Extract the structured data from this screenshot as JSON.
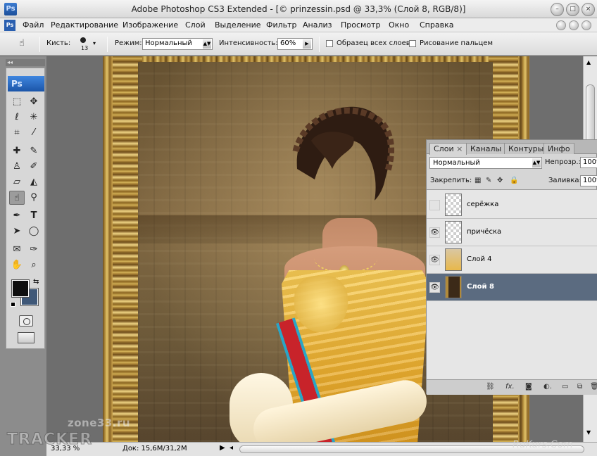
{
  "window": {
    "app_icon": "Ps",
    "title": "Adobe Photoshop CS3 Extended - [© prinzessin.psd @ 33,3% (Слой 8, RGB/8)]",
    "controls": [
      "minimize-icon",
      "maximize-icon",
      "close-icon"
    ]
  },
  "menu": {
    "app_icon": "Ps",
    "items": [
      "Файл",
      "Редактирование",
      "Изображение",
      "Слой",
      "Выделение",
      "Фильтр",
      "Анализ",
      "Просмотр",
      "Окно",
      "Справка"
    ]
  },
  "options": {
    "brush_label": "Кисть:",
    "brush_size": "13",
    "mode_label": "Режим:",
    "mode_value": "Нормальный",
    "intensity_label": "Интенсивность:",
    "intensity_value": "60%",
    "sample_all_label": "Образец всех слоев",
    "finger_paint_label": "Рисование пальцем",
    "sample_all_checked": false,
    "finger_paint_checked": false
  },
  "tools": {
    "logo": "Ps",
    "collapse_glyph": "◂◂",
    "items": [
      {
        "name": "marquee-tool",
        "glyph": "⬚"
      },
      {
        "name": "move-tool",
        "glyph": "✥"
      },
      {
        "name": "lasso-tool",
        "glyph": "ℓ"
      },
      {
        "name": "magic-wand-tool",
        "glyph": "✳"
      },
      {
        "name": "crop-tool",
        "glyph": "⌗"
      },
      {
        "name": "slice-tool",
        "glyph": "⁄"
      },
      {
        "name": "healing-brush-tool",
        "glyph": "✚"
      },
      {
        "name": "brush-tool",
        "glyph": "✎"
      },
      {
        "name": "clone-stamp-tool",
        "glyph": "♙"
      },
      {
        "name": "history-brush-tool",
        "glyph": "✐"
      },
      {
        "name": "eraser-tool",
        "glyph": "▱"
      },
      {
        "name": "paint-bucket-tool",
        "glyph": "◭"
      },
      {
        "name": "smudge-tool",
        "glyph": "☝"
      },
      {
        "name": "dodge-tool",
        "glyph": "🔍"
      },
      {
        "name": "pen-tool",
        "glyph": "✒"
      },
      {
        "name": "type-tool",
        "glyph": "T"
      },
      {
        "name": "path-selection-tool",
        "glyph": "➤"
      },
      {
        "name": "ellipse-tool",
        "glyph": "◯"
      },
      {
        "name": "notes-tool",
        "glyph": "✉"
      },
      {
        "name": "eyedropper-tool",
        "glyph": "✑"
      },
      {
        "name": "hand-tool",
        "glyph": "✋"
      },
      {
        "name": "zoom-tool",
        "glyph": "⌕"
      }
    ],
    "foreground_color": "#0f0f0f",
    "background_color": "#3f5878"
  },
  "layers_panel": {
    "tabs": [
      "Слои",
      "Каналы",
      "Контуры",
      "Инфо"
    ],
    "tab_close": "×",
    "blend_mode": "Нормальный",
    "opacity_label": "Непрозр.:",
    "opacity_value": "100%",
    "lock_label": "Закрепить:",
    "fill_label": "Заливка:",
    "fill_value": "100%",
    "layers": [
      {
        "name": "серёжка",
        "visible": false,
        "selected": false
      },
      {
        "name": "причёска",
        "visible": true,
        "selected": false
      },
      {
        "name": "Слой 4",
        "visible": true,
        "selected": false
      },
      {
        "name": "Слой 8",
        "visible": true,
        "selected": true
      }
    ],
    "bottom_icons": [
      "link-layers-icon",
      "fx-icon",
      "add-mask-icon",
      "adjustment-layer-icon",
      "new-group-icon",
      "new-layer-icon",
      "delete-layer-icon"
    ]
  },
  "status": {
    "zoom": "33,33 %",
    "doc_label": "Док: 15,6M/31,2M"
  },
  "watermarks": {
    "site1": "zone33.ru",
    "site2": "TRACKER",
    "site3": "RuKurs.Com"
  }
}
